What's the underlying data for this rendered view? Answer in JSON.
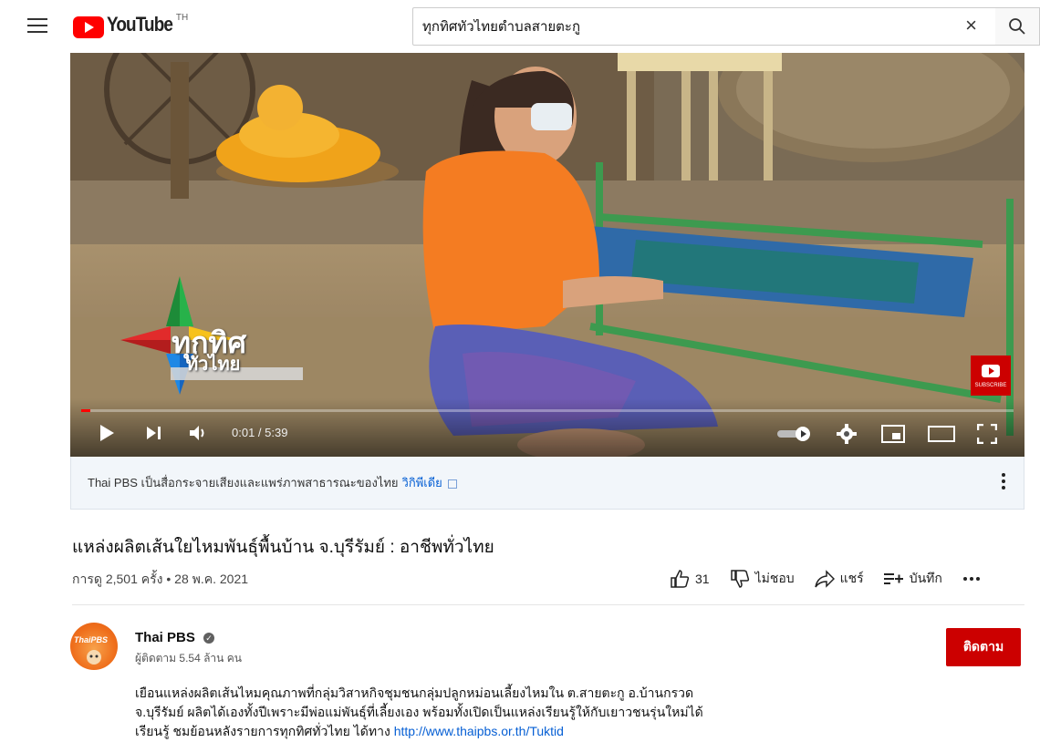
{
  "header": {
    "logo_text": "YouTube",
    "logo_country": "TH",
    "search_value": "ทุกทิศทั่วไทยตำบลสายตะกู",
    "clear_glyph": "×"
  },
  "player": {
    "time_display": "0:01 / 5:39",
    "progress_fraction": 0.003,
    "overlay_logo_line1": "ทุกทิศ",
    "overlay_logo_line2": "ทั่วไทย",
    "subscribe_badge": "SUBSCRIBE"
  },
  "info_banner": {
    "text": "Thai PBS เป็นสื่อกระจายเสียงและแพร่ภาพสาธารณะของไทย",
    "link": "วิกิพีเดีย"
  },
  "video": {
    "title": "แหล่งผลิตเส้นใยไหมพันธุ์พื้นบ้าน จ.บุรีรัมย์ : อาชีพทั่วไทย",
    "meta": "การดู 2,501 ครั้ง • 28 พ.ค. 2021",
    "likes": "31",
    "dislike_label": "ไม่ชอบ",
    "share_label": "แชร์",
    "save_label": "บันทึก"
  },
  "channel": {
    "avatar_text": "ThaiPBS",
    "name": "Thai PBS",
    "subscribers": "ผู้ติดตาม 5.54 ล้าน คน",
    "subscribe_label": "ติดตาม"
  },
  "description": {
    "line1": "เยือนแหล่งผลิตเส้นไหมคุณภาพที่กลุ่มวิสาหกิจชุมชนกลุ่มปลูกหม่อนเลี้ยงไหมใน ต.สายตะกู อ.บ้านกรวด",
    "line2": "จ.บุรีรัมย์ ผลิตได้เองทั้งปีเพราะมีพ่อแม่พันธุ์ที่เลี้ยงเอง พร้อมทั้งเปิดเป็นแหล่งเรียนรู้ให้กับเยาวชนรุ่นใหม่ได้",
    "line3_prefix": "เรียนรู้ ชมย้อนหลังรายการทุกทิศทั่วไทย ได้ทาง",
    "line3_link": "http://www.thaipbs.or.th/Tuktid"
  },
  "colors": {
    "brand_red": "#ff0000",
    "subscribe_red": "#cc0000",
    "link_blue": "#065fd4"
  }
}
